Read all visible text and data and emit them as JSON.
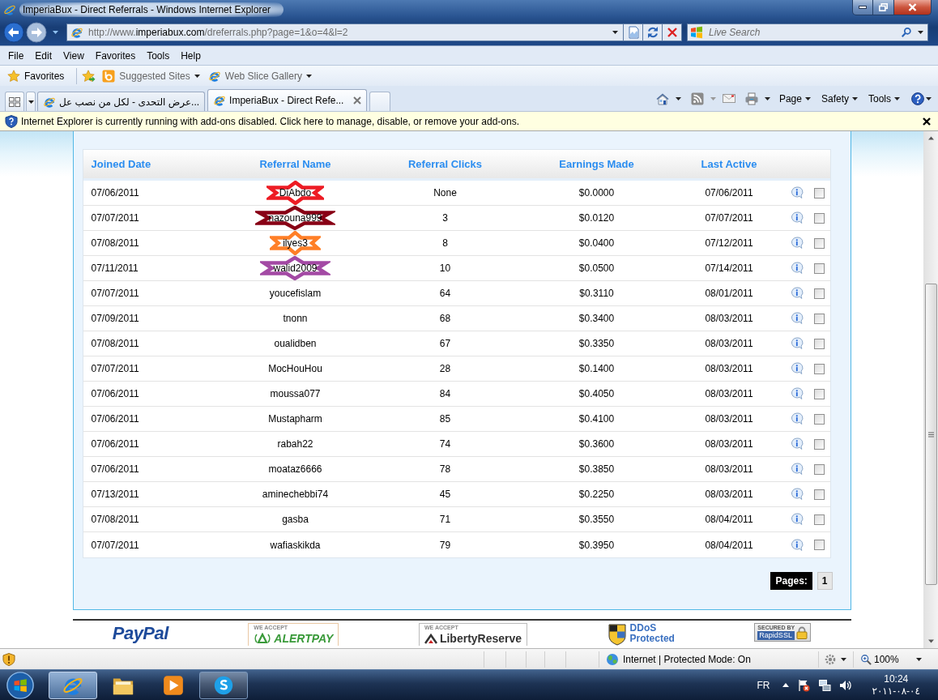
{
  "window": {
    "title": "ImperiaBux - Direct Referrals - Windows Internet Explorer"
  },
  "address_bar": {
    "url_prefix": "http://www.",
    "url_domain": "imperiabux.com",
    "url_path": "/dreferrals.php?page=1&o=4&l=2"
  },
  "search": {
    "placeholder": "Live Search"
  },
  "menu": [
    "File",
    "Edit",
    "View",
    "Favorites",
    "Tools",
    "Help"
  ],
  "favorites_bar": {
    "favorites": "Favorites",
    "links": [
      "Suggested Sites",
      "Web Slice Gallery"
    ]
  },
  "tabs": [
    {
      "label": "عرض التحدى - لكل من نصب عل...",
      "selected": false
    },
    {
      "label": "ImperiaBux - Direct Refe...",
      "selected": true
    }
  ],
  "command_bar": [
    "Page",
    "Safety",
    "Tools"
  ],
  "info_bar": {
    "text": "Internet Explorer is currently running with add-ons disabled. Click here to manage, disable, or remove your add-ons."
  },
  "table": {
    "columns": [
      "Joined Date",
      "Referral Name",
      "Referral Clicks",
      "Earnings Made",
      "Last Active"
    ],
    "rows": [
      {
        "joined": "07/06/2011",
        "name": "DiAbdo",
        "name_mark": {
          "color": "#ed1c24"
        },
        "clicks": "None",
        "earnings": "$0.0000",
        "last_active": "07/06/2011",
        "checked": false
      },
      {
        "joined": "07/07/2011",
        "name": "nazouna999",
        "name_mark": {
          "color": "#880015"
        },
        "clicks": "3",
        "earnings": "$0.0120",
        "last_active": "07/07/2011",
        "checked": false
      },
      {
        "joined": "07/08/2011",
        "name": "ilyes3",
        "name_mark": {
          "color": "#ff7f27"
        },
        "clicks": "8",
        "earnings": "$0.0400",
        "last_active": "07/12/2011",
        "checked": false
      },
      {
        "joined": "07/11/2011",
        "name": "walid2009",
        "name_mark": {
          "color": "#a349a4"
        },
        "clicks": "10",
        "earnings": "$0.0500",
        "last_active": "07/14/2011",
        "checked": false
      },
      {
        "joined": "07/07/2011",
        "name": "youcefislam",
        "clicks": "64",
        "earnings": "$0.3110",
        "last_active": "08/01/2011",
        "checked": false
      },
      {
        "joined": "07/09/2011",
        "name": "tnonn",
        "clicks": "68",
        "earnings": "$0.3400",
        "last_active": "08/03/2011",
        "checked": false
      },
      {
        "joined": "07/08/2011",
        "name": "oualidben",
        "clicks": "67",
        "earnings": "$0.3350",
        "last_active": "08/03/2011",
        "checked": false
      },
      {
        "joined": "07/07/2011",
        "name": "MocHouHou",
        "clicks": "28",
        "earnings": "$0.1400",
        "last_active": "08/03/2011",
        "checked": false
      },
      {
        "joined": "07/06/2011",
        "name": "moussa077",
        "clicks": "84",
        "earnings": "$0.4050",
        "last_active": "08/03/2011",
        "checked": false
      },
      {
        "joined": "07/06/2011",
        "name": "Mustapharm",
        "clicks": "85",
        "earnings": "$0.4100",
        "last_active": "08/03/2011",
        "checked": false
      },
      {
        "joined": "07/06/2011",
        "name": "rabah22",
        "clicks": "74",
        "earnings": "$0.3600",
        "last_active": "08/03/2011",
        "checked": false
      },
      {
        "joined": "07/06/2011",
        "name": "moataz6666",
        "clicks": "78",
        "earnings": "$0.3850",
        "last_active": "08/03/2011",
        "checked": false
      },
      {
        "joined": "07/13/2011",
        "name": "aminechebbi74",
        "clicks": "45",
        "earnings": "$0.2250",
        "last_active": "08/03/2011",
        "checked": false
      },
      {
        "joined": "07/08/2011",
        "name": "gasba",
        "clicks": "71",
        "earnings": "$0.3550",
        "last_active": "08/04/2011",
        "checked": false
      },
      {
        "joined": "07/07/2011",
        "name": "wafiaskikda",
        "clicks": "79",
        "earnings": "$0.3950",
        "last_active": "08/04/2011",
        "checked": false
      }
    ]
  },
  "pagination": {
    "label": "Pages:",
    "pages": [
      "1"
    ]
  },
  "payment_logos": [
    {
      "kind": "paypal",
      "texts": [
        "PayPal"
      ]
    },
    {
      "kind": "alertpay",
      "texts": [
        "WE ACCEPT",
        "ALERTPAY"
      ]
    },
    {
      "kind": "liberty",
      "texts": [
        "WE ACCEPT",
        "LibertyReserve"
      ]
    },
    {
      "kind": "ddos",
      "texts": [
        "DDoS",
        "Protected"
      ]
    },
    {
      "kind": "rapidssl",
      "texts": [
        "SECURED BY",
        "RapidSSL"
      ]
    }
  ],
  "status_bar": {
    "zone": "Internet | Protected Mode: On",
    "zoom": "100%"
  },
  "taskbar": {
    "apps": [
      {
        "running": true,
        "selected": true
      },
      {
        "running": false,
        "selected": false
      },
      {
        "running": false,
        "selected": false
      },
      {
        "running": true,
        "selected": false
      }
    ],
    "language": "FR",
    "time": "10:24",
    "date": "٢٠١١-٠٨-٠٤"
  }
}
